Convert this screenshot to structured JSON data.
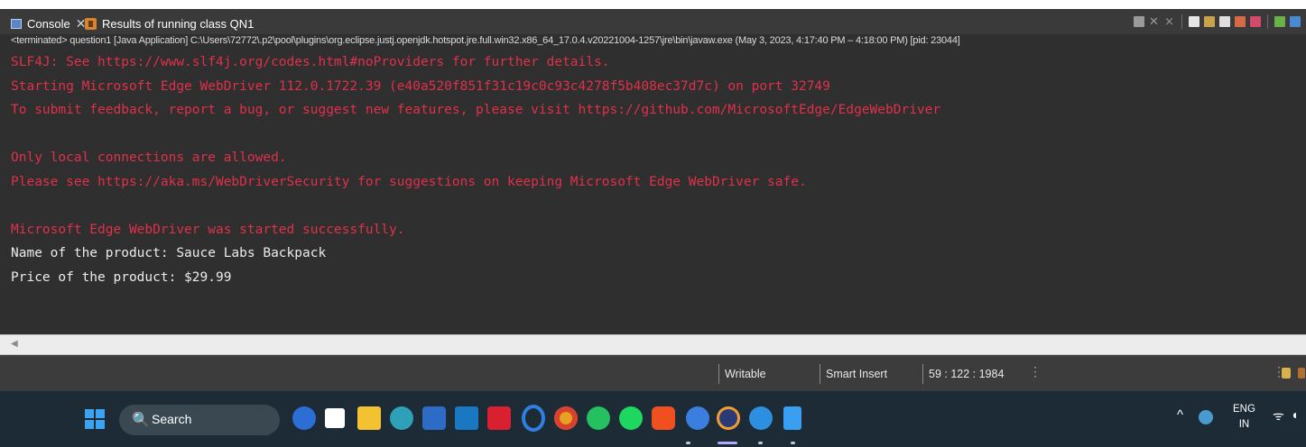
{
  "tabs": [
    {
      "label": "Console",
      "close_glyph": "✕",
      "icon": "console-icon",
      "active": true
    },
    {
      "label": "Results of running class QN1",
      "icon": "results-icon",
      "active": false
    }
  ],
  "process_line": "<terminated> question1 [Java Application] C:\\Users\\72772\\.p2\\pool\\plugins\\org.eclipse.justj.openjdk.hotspot.jre.full.win32.x86_64_17.0.4.v20221004-1257\\jre\\bin\\javaw.exe  (May 3, 2023, 4:17:40 PM – 4:18:00 PM) [pid: 23044]",
  "console_lines": [
    {
      "text": "SLF4J: See https://www.slf4j.org/codes.html#noProviders for further details.",
      "kind": "err"
    },
    {
      "text": "Starting Microsoft Edge WebDriver 112.0.1722.39 (e40a520f851f31c19c0c93c4278f5b408ec37d7c) on port 32749",
      "kind": "err"
    },
    {
      "text": "To submit feedback, report a bug, or suggest new features, please visit https://github.com/MicrosoftEdge/EdgeWebDriver",
      "kind": "err"
    },
    {
      "text": "",
      "kind": "blank"
    },
    {
      "text": "Only local connections are allowed.",
      "kind": "err"
    },
    {
      "text": "Please see https://aka.ms/WebDriverSecurity for suggestions on keeping Microsoft Edge WebDriver safe.",
      "kind": "err"
    },
    {
      "text": "",
      "kind": "blank"
    },
    {
      "text": "Microsoft Edge WebDriver was started successfully.",
      "kind": "err"
    },
    {
      "text": "Name of the product: Sauce Labs Backpack",
      "kind": "out"
    },
    {
      "text": "Price of the product: $29.99",
      "kind": "out"
    }
  ],
  "status_bar": {
    "writable": "Writable",
    "insert_mode": "Smart Insert",
    "position": "59 : 122 : 1984",
    "menu_glyph": "⋮"
  },
  "taskbar": {
    "search_label": "Search",
    "search_glyph": "🔍",
    "lang_line1": "ENG",
    "lang_line2": "IN",
    "tray_chevron": "^"
  },
  "colors": {
    "stderr": "#e0304a",
    "stdout": "#ebebeb",
    "console_bg": "#2f2f2f",
    "taskbar_bg": "#1c2b36"
  }
}
